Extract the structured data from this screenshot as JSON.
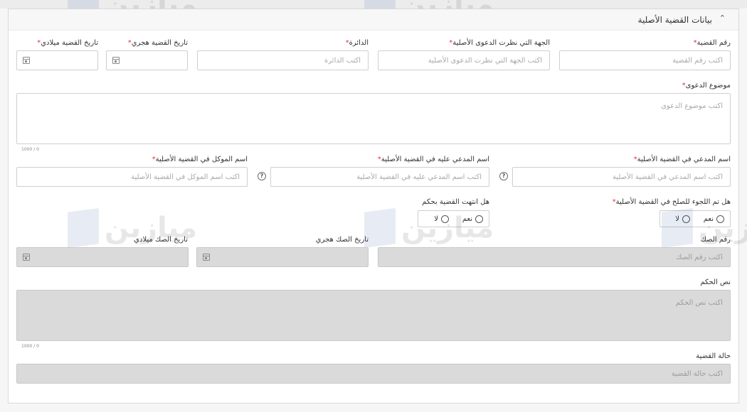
{
  "section": {
    "title": "بيانات القضية الأصلية",
    "toggle_icon": "chevron-up-icon"
  },
  "watermark": {
    "text": "ميازين"
  },
  "fields": {
    "case_number": {
      "label": "رقم القضية",
      "placeholder": "اكتب رقم القضية",
      "required": true
    },
    "authority": {
      "label": "الجهة التي نظرت الدعوى الأصلية",
      "placeholder": "اكتب الجهة التي نظرت الدعوى الأصلية",
      "required": true
    },
    "circuit": {
      "label": "الدائرة",
      "placeholder": "اكتب الدائرة",
      "required": true
    },
    "case_date_hijri": {
      "label": "تاريخ القضية هجري",
      "value": "",
      "required": true
    },
    "case_date_gregorian": {
      "label": "تاريخ القضية ميلادي",
      "value": "",
      "required": true
    },
    "subject": {
      "label": "موضوع الدعوى",
      "placeholder": "اكتب موضوع الدعوى",
      "required": true,
      "counter": "1000 / 0"
    },
    "plaintiff": {
      "label": "اسم المدعي في القضية الأصلية",
      "placeholder": "اكتب اسم المدعي في القضية الأصلية",
      "required": true
    },
    "defendant": {
      "label": "اسم المدعي عليه في القضية الأصلية",
      "placeholder": "اكتب اسم المدعي عليه  في القضية الأصلية",
      "required": true
    },
    "client": {
      "label": "اسم الموكل في القضية الأصلية",
      "placeholder": "اكتب اسم الموكل في القضية الأصلية",
      "required": true
    },
    "settlement": {
      "label": "هل تم اللجوء للصلح في القضية الأصلية",
      "required": true,
      "options": [
        "نعم",
        "لا"
      ]
    },
    "ended_with_judgment": {
      "label": "هل انتهت القضية بحكم",
      "required": false,
      "options": [
        "نعم",
        "لا"
      ]
    },
    "deed_number": {
      "label": "رقم الصك",
      "placeholder": "اكتب رقم الصك"
    },
    "deed_date_hijri": {
      "label": "تاريخ الصك هجري",
      "value": ""
    },
    "deed_date_gregorian": {
      "label": "تاريخ الصك ميلادي",
      "value": ""
    },
    "judgment_text": {
      "label": "نص الحكم",
      "placeholder": "اكتب نص الحكم",
      "counter": "1000 / 0"
    },
    "case_status": {
      "label": "حالة القضية",
      "placeholder": "اكتب حالة القضية"
    }
  },
  "required_marker": "*"
}
